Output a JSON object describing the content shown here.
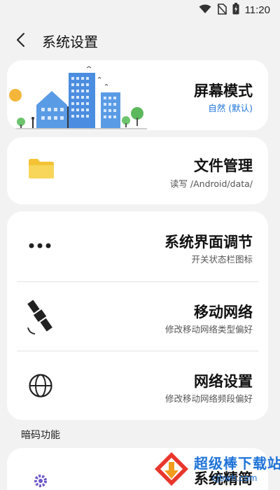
{
  "status_bar": {
    "time": "11:20"
  },
  "header": {
    "title": "系统设置"
  },
  "cards": {
    "screen": {
      "title": "屏幕模式",
      "subtitle": "自然 (默认)"
    },
    "files": {
      "title": "文件管理",
      "subtitle": "读写 /Android/data/"
    },
    "ui_tune": {
      "title": "系统界面调节",
      "subtitle": "开关状态栏图标"
    },
    "mobile": {
      "title": "移动网络",
      "subtitle": "修改移动网络类型偏好"
    },
    "network": {
      "title": "网络设置",
      "subtitle": "修改移动网络频段偏好"
    },
    "partial": {
      "title": "系统精简"
    }
  },
  "section": {
    "secret_codes": "暗码功能"
  },
  "watermark": {
    "text": "超级棒下载站",
    "url": "cjbwh.com"
  },
  "colors": {
    "subtitle_blue": "#1e73d8",
    "background": "#f2f2f2",
    "card": "#ffffff"
  }
}
